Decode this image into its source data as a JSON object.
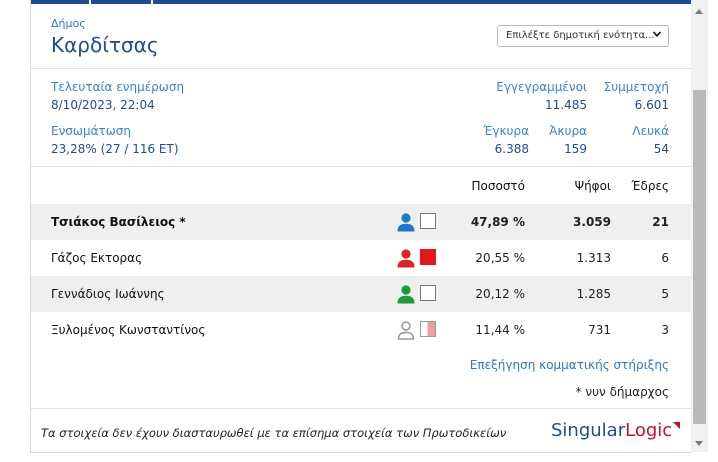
{
  "header": {
    "muni_label": "Δήμος",
    "muni_name": "Καρδίτσας",
    "select_value": "Επιλέξτε δημοτική ενότητα..."
  },
  "stats": {
    "last_update_label": "Τελευταία ενημέρωση",
    "last_update_value": "8/10/2023, 22:04",
    "registered_label": "Εγγεγραμμένοι",
    "registered_value": "11.485",
    "turnout_label": "Συμμετοχή",
    "turnout_value": "6.601",
    "integration_label": "Ενσωμάτωση",
    "integration_value": "23,28% (27 / 116 ΕΤ)",
    "valid_label": "Έγκυρα",
    "valid_value": "6.388",
    "invalid_label": "Άκυρα",
    "invalid_value": "159",
    "blank_label": "Λευκά",
    "blank_value": "54"
  },
  "table": {
    "headers": {
      "percent": "Ποσοστό",
      "votes": "Ψήφοι",
      "seats": "Έδρες"
    },
    "rows": [
      {
        "name": "Τσιάκος Βασίλειος *",
        "percent": "47,89 %",
        "votes": "3.059",
        "seats": "21",
        "person_color": "#1e7ac8",
        "swatch_color": "#ffffff"
      },
      {
        "name": "Γάζος Εκτορας",
        "percent": "20,55 %",
        "votes": "1.313",
        "seats": "6",
        "person_color": "#d9252a",
        "swatch_color": "#e3161d"
      },
      {
        "name": "Γεννάδιος Ιωάννης",
        "percent": "20,12 %",
        "votes": "1.285",
        "seats": "5",
        "person_color": "#1e9a3a",
        "swatch_color": "#ffffff"
      },
      {
        "name": "Ξυλομένος Κωνσταντίνος",
        "percent": "11,44 %",
        "votes": "731",
        "seats": "3",
        "person_color": "#9a9a9a",
        "swatch_color": "#e8a0a0"
      }
    ]
  },
  "links": {
    "party_support": "Επεξήγηση κομματικής στήριξης",
    "incumbent_note": "* νυν δήμαρχος"
  },
  "footer": {
    "disclaimer": "Τα στοιχεία δεν έχουν διασταυρωθεί με τα επίσημα στοιχεία των Πρωτοδικείων",
    "logo_part1": "Singular",
    "logo_part2": "Logic"
  },
  "colors": {
    "brand_blue": "#1f4e8c",
    "label_blue": "#2b7bbf",
    "logo_red": "#c8102e"
  }
}
